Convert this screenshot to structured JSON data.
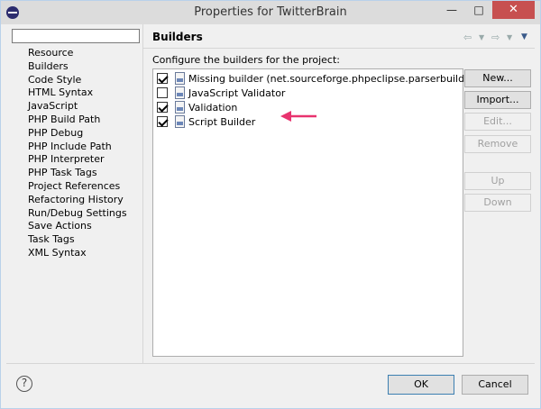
{
  "window": {
    "title": "Properties for TwitterBrain",
    "minimize": "—",
    "maximize": "□",
    "close": "✕"
  },
  "sidebar": {
    "filter_placeholder": "",
    "items": [
      {
        "label": "Resource",
        "selected": false
      },
      {
        "label": "Builders",
        "selected": true
      },
      {
        "label": "Code Style",
        "selected": false
      },
      {
        "label": "HTML Syntax",
        "selected": false
      },
      {
        "label": "JavaScript",
        "selected": false
      },
      {
        "label": "PHP Build Path",
        "selected": false
      },
      {
        "label": "PHP Debug",
        "selected": false
      },
      {
        "label": "PHP Include Path",
        "selected": false
      },
      {
        "label": "PHP Interpreter",
        "selected": false
      },
      {
        "label": "PHP Task Tags",
        "selected": false
      },
      {
        "label": "Project References",
        "selected": false
      },
      {
        "label": "Refactoring History",
        "selected": false
      },
      {
        "label": "Run/Debug Settings",
        "selected": false
      },
      {
        "label": "Save Actions",
        "selected": false
      },
      {
        "label": "Task Tags",
        "selected": false
      },
      {
        "label": "XML Syntax",
        "selected": false
      }
    ]
  },
  "page": {
    "title": "Builders",
    "history": {
      "back": "⇦",
      "back_dd": "▼",
      "forward": "⇨",
      "forward_dd": "▼",
      "menu": "▼"
    },
    "description": "Configure the builders for the project:",
    "builders": [
      {
        "label": "Missing builder (net.sourceforge.phpeclipse.parserbuilder)",
        "checked": true
      },
      {
        "label": "JavaScript Validator",
        "checked": false
      },
      {
        "label": "Validation",
        "checked": true
      },
      {
        "label": "Script Builder",
        "checked": true
      }
    ],
    "buttons": {
      "new": "New...",
      "import": "Import...",
      "edit": "Edit...",
      "remove": "Remove",
      "up": "Up",
      "down": "Down"
    }
  },
  "footer": {
    "help": "?",
    "ok": "OK",
    "cancel": "Cancel"
  },
  "colors": {
    "annotation_arrow": "#e8336f",
    "builder_icon": "#6b86b8"
  }
}
